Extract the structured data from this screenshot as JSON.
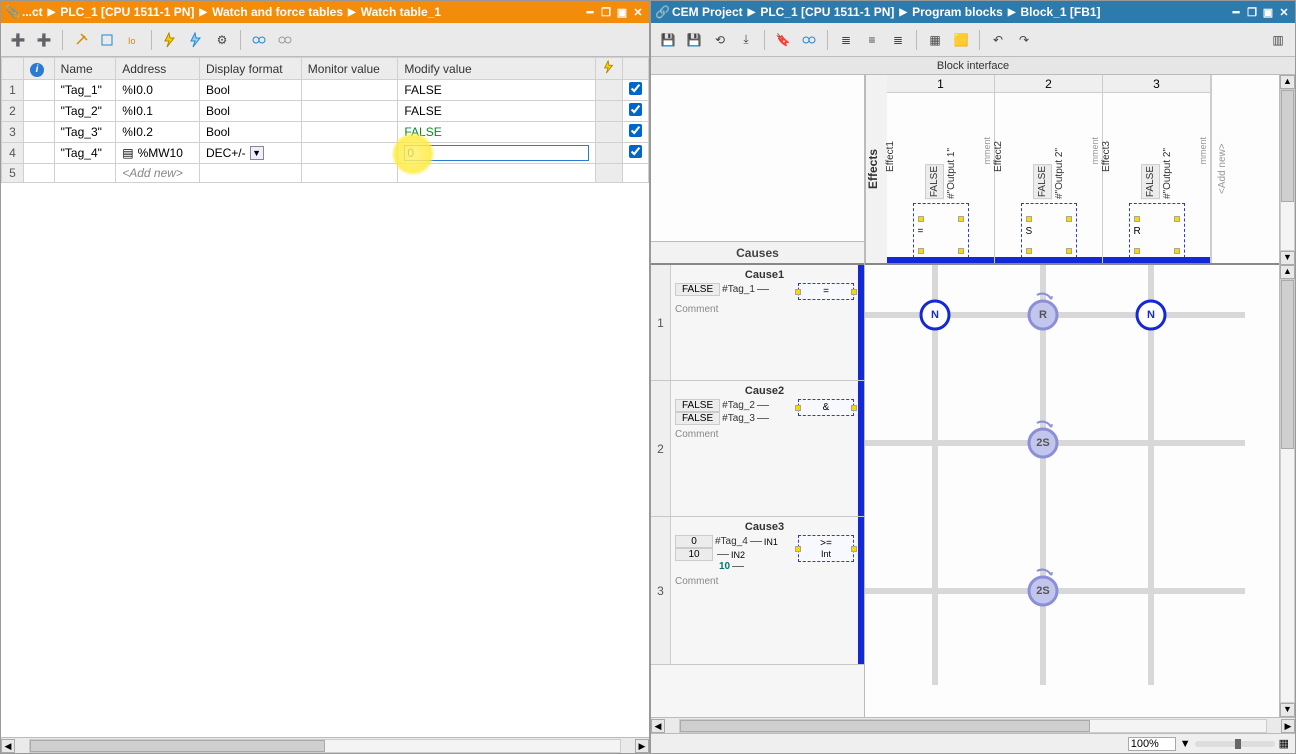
{
  "left_pane": {
    "breadcrumbs": [
      "...ct",
      "PLC_1 [CPU 1511-1 PN]",
      "Watch and force tables",
      "Watch table_1"
    ],
    "table": {
      "headers": {
        "info": "",
        "name": "Name",
        "address": "Address",
        "display_format": "Display format",
        "monitor": "Monitor value",
        "modify": "Modify value",
        "flash": "",
        "check": ""
      },
      "rows": [
        {
          "num": "1",
          "name": "\"Tag_1\"",
          "address": "%I0.0",
          "format": "Bool",
          "monitor": "",
          "modify": "FALSE",
          "checked": true
        },
        {
          "num": "2",
          "name": "\"Tag_2\"",
          "address": "%I0.1",
          "format": "Bool",
          "monitor": "",
          "modify": "FALSE",
          "checked": true
        },
        {
          "num": "3",
          "name": "\"Tag_3\"",
          "address": "%I0.2",
          "format": "Bool",
          "monitor": "",
          "modify": "FALSE",
          "modify_green": true,
          "checked": true
        },
        {
          "num": "4",
          "name": "\"Tag_4\"",
          "address": "%MW10",
          "address_dropdown": true,
          "format": "DEC+/-",
          "format_dropdown": true,
          "monitor": "",
          "modify": "0",
          "modify_editing": true,
          "checked": true
        },
        {
          "num": "5",
          "name": "",
          "address": "<Add new>",
          "addnew": true,
          "format": "",
          "monitor": "",
          "modify": "",
          "checked": false
        }
      ]
    }
  },
  "right_pane": {
    "breadcrumbs": [
      "CEM Project",
      "PLC_1 [CPU 1511-1 PN]",
      "Program blocks",
      "Block_1 [FB1]"
    ],
    "block_interface_label": "Block interface",
    "effects_label": "Effects",
    "causes_label": "Causes",
    "addnew_label": "<Add new>",
    "effects": [
      {
        "num": "1",
        "name": "Effect1",
        "output": "#\"Output 1\"",
        "val": "FALSE",
        "sym": "="
      },
      {
        "num": "2",
        "name": "Effect2",
        "output": "#\"Output 2\"",
        "val": "FALSE",
        "sym": "S"
      },
      {
        "num": "3",
        "name": "Effect3",
        "output": "#\"Output 2\"",
        "val": "FALSE",
        "sym": "R"
      }
    ],
    "causes": [
      {
        "num": "1",
        "title": "Cause1",
        "op": "=",
        "tags": [
          {
            "val": "FALSE",
            "name": "#Tag_1"
          }
        ],
        "comment": "Comment",
        "nodes": [
          {
            "col": 1,
            "label": "N",
            "active": true
          },
          {
            "col": 2,
            "label": "R",
            "active": false
          },
          {
            "col": 3,
            "label": "N",
            "active": true
          }
        ]
      },
      {
        "num": "2",
        "title": "Cause2",
        "op": "&",
        "tags": [
          {
            "val": "FALSE",
            "name": "#Tag_2"
          },
          {
            "val": "FALSE",
            "name": "#Tag_3"
          }
        ],
        "comment": "Comment",
        "nodes": [
          {
            "col": 2,
            "label": "2S",
            "active": false
          }
        ]
      },
      {
        "num": "3",
        "title": "Cause3",
        "op": ">=",
        "op2": "Int",
        "tags": [
          {
            "val": "0",
            "name": "#Tag_4",
            "pin": "IN1"
          },
          {
            "val": "10",
            "literal": "10",
            "pin": "IN2",
            "tint": true
          }
        ],
        "comment": "Comment",
        "nodes": [
          {
            "col": 2,
            "label": "2S",
            "active": false
          }
        ]
      }
    ],
    "zoom": "100%",
    "comment_label": "mment"
  }
}
